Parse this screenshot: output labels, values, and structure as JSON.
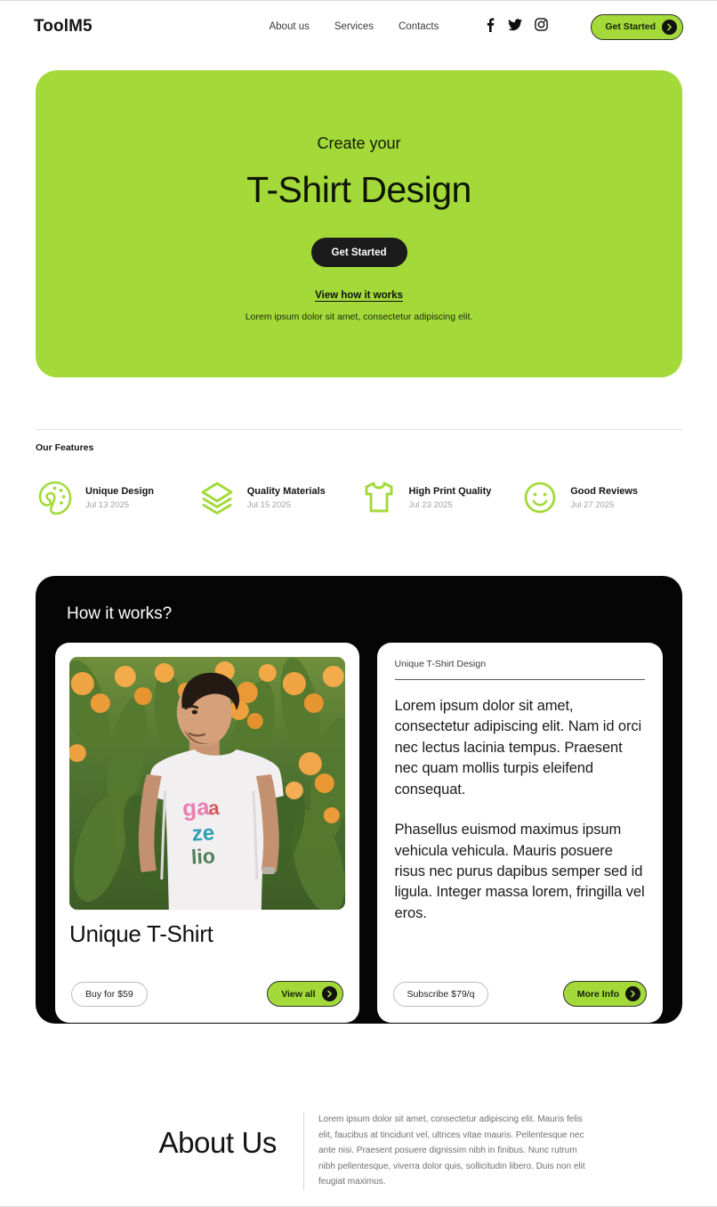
{
  "header": {
    "logo": "ToolM5",
    "nav": [
      {
        "label": "About us"
      },
      {
        "label": "Services"
      },
      {
        "label": "Contacts"
      }
    ],
    "socials": [
      {
        "name": "facebook-icon"
      },
      {
        "name": "twitter-icon"
      },
      {
        "name": "instagram-icon"
      }
    ],
    "cta_label": "Get Started"
  },
  "hero": {
    "eyebrow": "Create your",
    "title": "T-Shirt Design",
    "cta_label": "Get Started",
    "link_label": "View how it works",
    "subtext": "Lorem ipsum dolor sit amet, consectetur adipiscing elit.",
    "background_color": "#a3da39"
  },
  "features": {
    "title": "Our Features",
    "items": [
      {
        "icon": "palette-icon",
        "name": "Unique Design",
        "date": "Jul 13 2025"
      },
      {
        "icon": "layers-icon",
        "name": "Quality Materials",
        "date": "Jul 15 2025"
      },
      {
        "icon": "tshirt-icon",
        "name": "High Print Quality",
        "date": "Jul 23 2025"
      },
      {
        "icon": "smiley-icon",
        "name": "Good Reviews",
        "date": "Jul 27 2025"
      }
    ]
  },
  "how_it_works": {
    "title": "How it works?",
    "left_card": {
      "image_alt": "Man in white t-shirt with ga ze lio print standing in front of orange flowers",
      "heading": "Unique T-Shirt",
      "buy_label": "Buy for $59",
      "view_all_label": "View all"
    },
    "right_card": {
      "kicker": "Unique T-Shirt Design",
      "paragraph_1": "Lorem ipsum dolor sit amet, consectetur adipiscing elit. Nam id orci nec lectus lacinia tempus. Praesent nec quam mollis turpis eleifend consequat.",
      "paragraph_2": "Phasellus euismod maximus ipsum vehicula vehicula. Mauris posuere risus nec purus dapibus semper sed id ligula. Integer massa lorem, fringilla vel eros.",
      "subscribe_label": "Subscribe $79/q",
      "more_info_label": "More Info"
    }
  },
  "about": {
    "title": "About Us",
    "text": "Lorem ipsum dolor sit amet, consectetur adipiscing elit. Mauris felis elit, faucibus at tincidunt vel, ultrices vitae mauris. Pellentesque nec ante nisi. Praesent posuere dignissim nibh in finibus. Nunc rutrum nibh pellentesque, viverra dolor quis, sollicitudin libero. Duis non elit feugiat maximus."
  },
  "colors": {
    "accent_green": "#a3da39",
    "dark": "#050505",
    "muted": "#a2a2a2"
  }
}
